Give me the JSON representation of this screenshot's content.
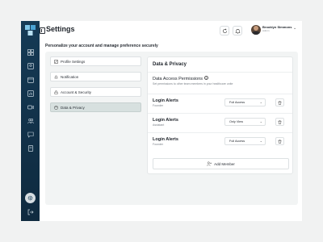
{
  "header": {
    "title": "Settings",
    "subtitle": "Personalize your account and manage preference securely"
  },
  "user": {
    "name": "Brooklyn Simmons",
    "role": "Admin"
  },
  "sidebar": {
    "icons": [
      "grid-icon",
      "users-icon",
      "calendar-icon",
      "chart-icon",
      "video-icon",
      "group-icon",
      "chat-icon",
      "document-icon"
    ],
    "bottom": [
      "settings-icon",
      "logout-icon"
    ]
  },
  "menu": {
    "items": [
      {
        "label": "Profile Settings",
        "icon": "profile-icon"
      },
      {
        "label": "Notification",
        "icon": "bell-icon"
      },
      {
        "label": "Account & Security",
        "icon": "lock-icon"
      },
      {
        "label": "Data & Privacy",
        "icon": "database-icon"
      }
    ],
    "active": "Data & Privacy"
  },
  "panel": {
    "title": "Data & Privacy",
    "section_title": "Data Access Permissions",
    "section_desc": "Set permissions to other team members in your healthcare unite",
    "rows": [
      {
        "name": "Login Alerts",
        "role": "Founder",
        "access": "Full Access"
      },
      {
        "name": "Login Alerts",
        "role": "Assistant",
        "access": "Only View"
      },
      {
        "name": "Login Alerts",
        "role": "Founder",
        "access": "Full Access"
      }
    ],
    "add_label": "Add Member"
  },
  "colors": {
    "sidebar": "#153a55",
    "active_menu": "#d7e0df",
    "background": "#f1f2f2"
  }
}
